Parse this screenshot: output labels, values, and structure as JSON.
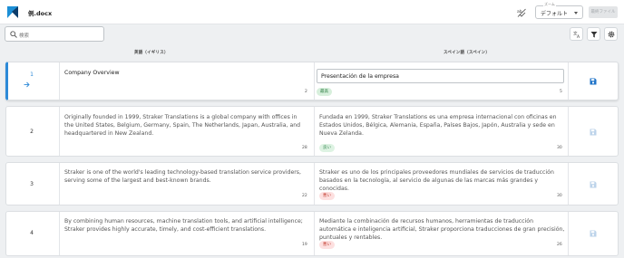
{
  "app": {
    "document_title": "例.docx",
    "zoom_label": "ズーム",
    "zoom_value": "デフォルト",
    "save_label": "最終ファイル",
    "search_placeholder": "検索"
  },
  "columns": {
    "source": "英語（イギリス）",
    "target": "スペイン語（スペイン）"
  },
  "colors": {
    "accent": "#2d8ad8",
    "save_active": "#1e73c8",
    "save_disabled": "#bcd3ea"
  },
  "rows": [
    {
      "number": "1",
      "source": "Company Overview",
      "source_count": "2",
      "target": "Presentación de la empresa",
      "target_count": "5",
      "quality": "最高"
    },
    {
      "number": "2",
      "source": "Originally founded in 1999, Straker Translations is a global company with offices in the United States, Belgium, Germany, Spain, The Netherlands, Japan, Australia, and headquartered in New Zealand.",
      "source_count": "28",
      "target": "Fundada en 1999, Straker Translations es una empresa internacional con oficinas en Estados Unidos, Bélgica, Alemania, España, Países Bajos, Japón, Australia y sede en Nueva Zelanda.",
      "target_count": "30",
      "quality": "良い"
    },
    {
      "number": "3",
      "source": "Straker is one of the world's leading technology-based translation service providers, serving some of the largest and best-known brands.",
      "source_count": "22",
      "target": "Straker es uno de los principales proveedores mundiales de servicios de traducción basados en la tecnología, al servicio de algunas de las marcas más grandes y conocidas.",
      "target_count": "30",
      "quality": "悪い"
    },
    {
      "number": "4",
      "source": "By combining human resources, machine translation tools, and artificial intelligence; Straker provides highly accurate, timely, and cost-efficient translations.",
      "source_count": "19",
      "target": "Mediante la combinación de recursos humanos, herramientas de traducción automática e inteligencia artificial, Straker proporciona traducciones de gran precisión, puntuales y rentables.",
      "target_count": "26",
      "quality": "悪い"
    }
  ]
}
